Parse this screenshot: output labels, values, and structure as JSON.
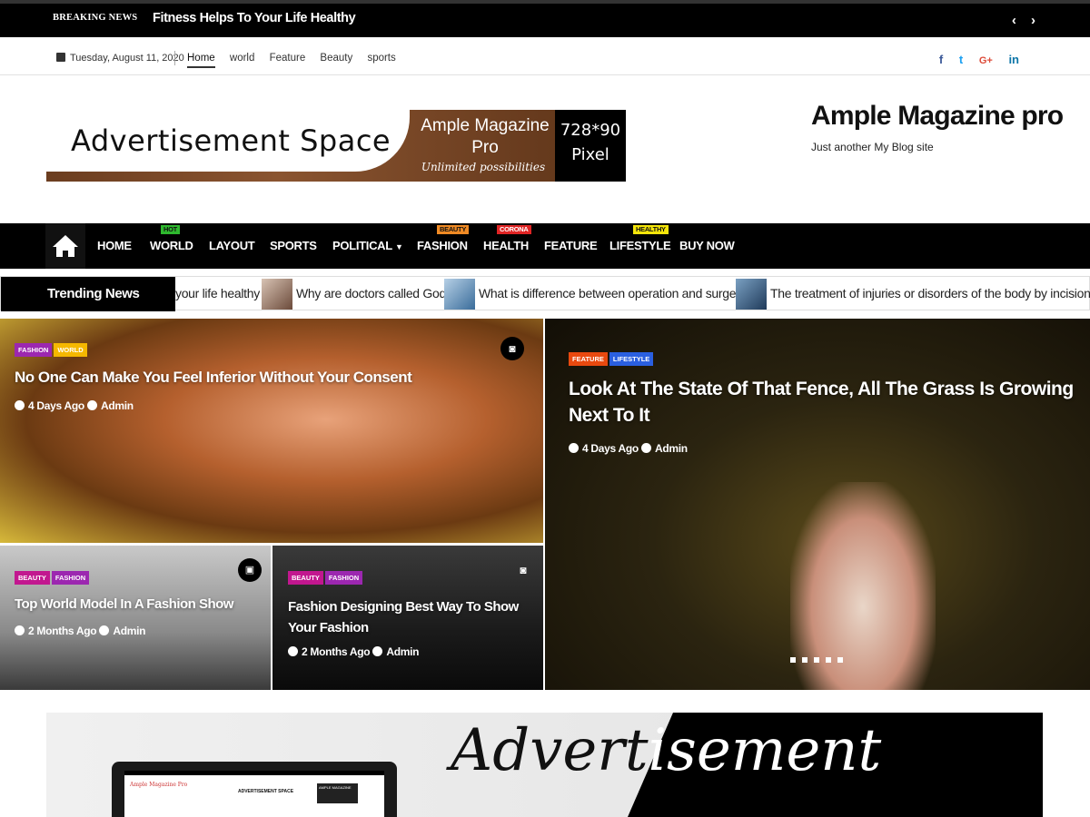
{
  "breaking": {
    "label": "BREAKING NEWS",
    "headline": "Fitness Helps To Your Life Healthy",
    "prev": "‹",
    "next": "›"
  },
  "topbar": {
    "date": "Tuesday, August 11, 2020",
    "menu": [
      "Home",
      "world",
      "Feature",
      "Beauty",
      "sports"
    ],
    "social": {
      "facebook": "f",
      "twitter": "t",
      "google": "G+",
      "linkedin": "in"
    },
    "colors": {
      "facebook": "#3b5998",
      "twitter": "#1da1f2",
      "google": "#dd4b39",
      "linkedin": "#0e76a8"
    }
  },
  "ad": {
    "text": "Advertisement Space",
    "brand_line1": "Ample Magazine",
    "brand_line2": "Pro",
    "tagline": "Unlimited possibilities",
    "size_line1": "728*90",
    "size_line2": "Pixel"
  },
  "site": {
    "title": "Ample Magazine pro",
    "description": "Just another My Blog site"
  },
  "nav": {
    "items": [
      {
        "label": "HOME",
        "badge": ""
      },
      {
        "label": "WORLD",
        "badge": "HOT",
        "badge_color": "#2eb82e"
      },
      {
        "label": "LAYOUT",
        "badge": ""
      },
      {
        "label": "SPORTS",
        "badge": ""
      },
      {
        "label": "POLITICAL",
        "badge": ""
      },
      {
        "label": "FASHION",
        "badge": "BEAUTY",
        "badge_color": "#f08a24"
      },
      {
        "label": "HEALTH",
        "badge": "CORONA",
        "badge_color": "#e02424"
      },
      {
        "label": "FEATURE",
        "badge": ""
      },
      {
        "label": "LIFESTYLE",
        "badge": "HEALTHY",
        "badge_color": "#f5e50a"
      },
      {
        "label": "BUY NOW",
        "badge": ""
      }
    ]
  },
  "trending": {
    "label": "Trending News",
    "items": [
      "your life healthy",
      "Why are doctors called God?",
      "What is difference between operation and surgery?",
      "The treatment of injuries or disorders of the body by incision"
    ]
  },
  "posts": [
    {
      "cats": [
        "FASHION",
        "WORLD"
      ],
      "title": "No One Can Make You Feel Inferior Without Your Consent",
      "time": "4 Days Ago",
      "author": "Admin"
    },
    {
      "cats": [
        "FEATURE",
        "LIFESTYLE"
      ],
      "title": "Look At The State Of That Fence, All The Grass Is Growing Next To It",
      "time": "4 Days Ago",
      "author": "Admin"
    },
    {
      "cats": [
        "BEAUTY",
        "FASHION"
      ],
      "title": "Top World Model In A Fashion Show",
      "time": "2 Months Ago",
      "author": "Admin"
    },
    {
      "cats": [
        "BEAUTY",
        "FASHION"
      ],
      "title": "Fashion Designing Best Way To Show Your Fashion",
      "time": "2 Months Ago",
      "author": "Admin"
    }
  ],
  "category_colors": {
    "FASHION": "#9c27b0",
    "WORLD": "#f5b800",
    "FEATURE": "#e8490f",
    "LIFESTYLE": "#2a5fe0",
    "BEAUTY": "#c2178f"
  },
  "bottom_ad": {
    "text_dark": "Advert",
    "text_light": "isement",
    "laptop_site": "Ample Magazine Pro",
    "laptop_ad": "ADVERTISEMENT SPACE",
    "laptop_box": "AMPLE MAGAZINE"
  }
}
